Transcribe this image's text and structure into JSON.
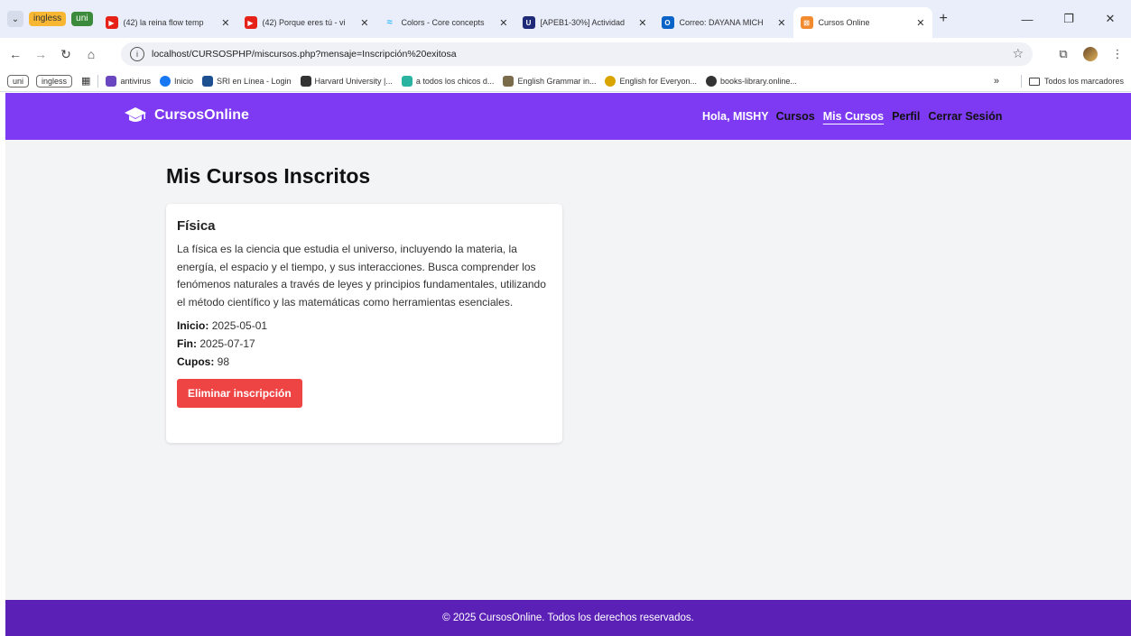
{
  "browser": {
    "chips": [
      "ingless",
      "uni"
    ],
    "tabs": [
      {
        "title": "(42) la reina flow temp",
        "favicon": "youtube-icon",
        "color": "#e62117"
      },
      {
        "title": "(42) Porque eres tú - vi",
        "favicon": "youtube-icon",
        "color": "#e62117"
      },
      {
        "title": "Colors - Core concepts",
        "favicon": "tailwind-icon",
        "color": "#38bdf8"
      },
      {
        "title": "[APEB1-30%] Actividad",
        "favicon": "u-icon",
        "color": "#1e2a78"
      },
      {
        "title": "Correo: DAYANA MICH",
        "favicon": "outlook-icon",
        "color": "#0a64c8"
      },
      {
        "title": "Cursos Online",
        "favicon": "xampp-icon",
        "color": "#f28b30",
        "active": true
      }
    ],
    "url": "localhost/CURSOSPHP/miscursos.php?mensaje=Inscripción%20exitosa",
    "bookmarks": {
      "chips": [
        "uni",
        "ingless"
      ],
      "items": [
        {
          "label": "antivirus",
          "color": "#6b46c1"
        },
        {
          "label": "Inicio",
          "color": "#1877f2"
        },
        {
          "label": "SRI en Línea - Login",
          "color": "#1d4f91"
        },
        {
          "label": "Harvard University |...",
          "color": "#333333"
        },
        {
          "label": "a todos los chicos d...",
          "color": "#2bb3a1"
        },
        {
          "label": "English Grammar in...",
          "color": "#7a6b4a"
        },
        {
          "label": "English for Everyon...",
          "color": "#d9a400"
        },
        {
          "label": "books-library.online...",
          "color": "#333333"
        }
      ],
      "all_label": "Todos los marcadores"
    }
  },
  "site": {
    "brand": "CursosOnline",
    "greeting": "Hola, MISHY",
    "nav": {
      "cursos": "Cursos",
      "mis_cursos": "Mis Cursos",
      "perfil": "Perfil",
      "logout": "Cerrar Sesión"
    },
    "colors": {
      "header": "#7e3af2",
      "footer": "#5b21b6",
      "danger": "#ef4444"
    }
  },
  "main": {
    "title": "Mis Cursos Inscritos",
    "course": {
      "name": "Física",
      "description": "La física es la ciencia que estudia el universo, incluyendo la materia, la energía, el espacio y el tiempo, y sus interacciones. Busca comprender los fenómenos naturales a través de leyes y principios fundamentales, utilizando el método científico y las matemáticas como herramientas esenciales.",
      "start_label": "Inicio:",
      "start": "2025-05-01",
      "end_label": "Fin:",
      "end": "2025-07-17",
      "seats_label": "Cupos:",
      "seats": "98",
      "remove_label": "Eliminar inscripción"
    }
  },
  "footer": {
    "text": "© 2025 CursosOnline. Todos los derechos reservados."
  }
}
